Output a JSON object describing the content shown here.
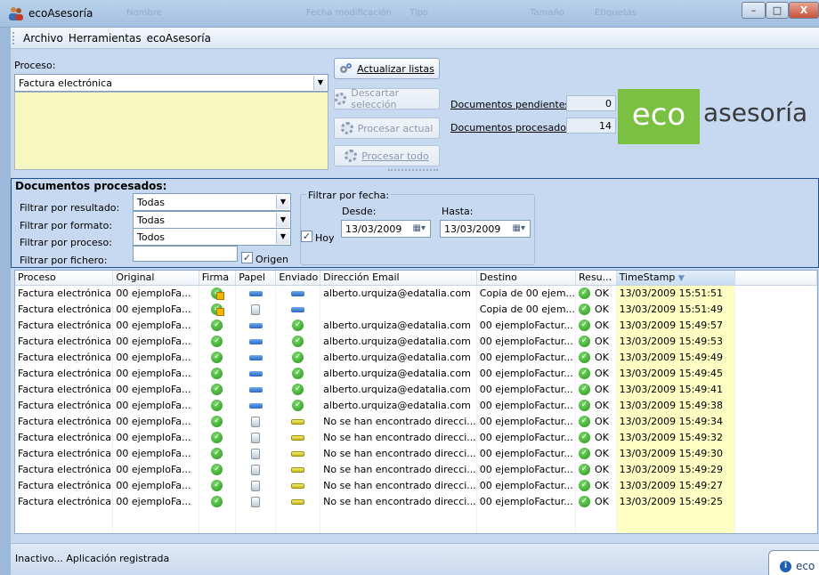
{
  "window": {
    "title": "ecoAsesoría",
    "ghost_columns": [
      "Nombre",
      "Fecha modificación",
      "Tipo",
      "Tamaño",
      "Etiquetas"
    ],
    "min_label": "–",
    "max_label": "□",
    "close_label": "X"
  },
  "menu": [
    "Archivo",
    "Herramientas",
    "ecoAsesoría"
  ],
  "proceso": {
    "label": "Proceso:",
    "selected": "Factura electrónica"
  },
  "buttons": {
    "actualizar": "Actualizar listas",
    "descartar": "Descartar selección",
    "procesar_actual": "Procesar actual",
    "procesar_todo": "Procesar todo"
  },
  "counters": {
    "pendientes_label": "Documentos pendientes:",
    "pendientes_value": "0",
    "procesados_label": "Documentos procesados:",
    "procesados_value": "14"
  },
  "logo": {
    "eco": "eco",
    "rest": "asesoría"
  },
  "filters": {
    "section_title": "Documentos procesados:",
    "resultado_label": "Filtrar por resultado:",
    "resultado_value": "Todas",
    "formato_label": "Filtrar por formato:",
    "formato_value": "Todas",
    "proceso_label": "Filtrar por proceso:",
    "proceso_value": "Todos",
    "fichero_label": "Filtrar por fichero:",
    "fichero_value": "",
    "origen_label": "Origen",
    "origen_checked": true,
    "fecha_group_label": "Filtrar por fecha:",
    "hoy_label": "Hoy",
    "hoy_checked": true,
    "desde_label": "Desde:",
    "desde_value": "13/03/2009",
    "hasta_label": "Hasta:",
    "hasta_value": "13/03/2009"
  },
  "grid": {
    "columns": [
      "Proceso",
      "Original",
      "Firma",
      "Papel",
      "Enviado",
      "Dirección Email",
      "Destino",
      "Resu...",
      "TimeStamp"
    ],
    "sorted_column": "TimeStamp",
    "rows": [
      {
        "proceso": "Factura electrónica",
        "original": "00 ejemploFa...",
        "firma": "warn",
        "papel": "blue",
        "enviado": "blue",
        "email": "alberto.urquiza@edatalia.com",
        "destino": "Copia de 00 ejem...",
        "resultado": "OK",
        "timestamp": "13/03/2009 15:51:51"
      },
      {
        "proceso": "Factura electrónica",
        "original": "00 ejemploFa...",
        "firma": "warn",
        "papel": "paper",
        "enviado": "blue",
        "email": "",
        "destino": "Copia de 00 ejem...",
        "resultado": "OK",
        "timestamp": "13/03/2009 15:51:49"
      },
      {
        "proceso": "Factura electrónica",
        "original": "00 ejemploFa...",
        "firma": "ok",
        "papel": "blue",
        "enviado": "ok",
        "email": "alberto.urquiza@edatalia.com",
        "destino": "00 ejemploFactur...",
        "resultado": "OK",
        "timestamp": "13/03/2009 15:49:57"
      },
      {
        "proceso": "Factura electrónica",
        "original": "00 ejemploFa...",
        "firma": "ok",
        "papel": "blue",
        "enviado": "ok",
        "email": "alberto.urquiza@edatalia.com",
        "destino": "00 ejemploFactur...",
        "resultado": "OK",
        "timestamp": "13/03/2009 15:49:53"
      },
      {
        "proceso": "Factura electrónica",
        "original": "00 ejemploFa...",
        "firma": "ok",
        "papel": "blue",
        "enviado": "ok",
        "email": "alberto.urquiza@edatalia.com",
        "destino": "00 ejemploFactur...",
        "resultado": "OK",
        "timestamp": "13/03/2009 15:49:49"
      },
      {
        "proceso": "Factura electrónica",
        "original": "00 ejemploFa...",
        "firma": "ok",
        "papel": "blue",
        "enviado": "ok",
        "email": "alberto.urquiza@edatalia.com",
        "destino": "00 ejemploFactur...",
        "resultado": "OK",
        "timestamp": "13/03/2009 15:49:45"
      },
      {
        "proceso": "Factura electrónica",
        "original": "00 ejemploFa...",
        "firma": "ok",
        "papel": "blue",
        "enviado": "ok",
        "email": "alberto.urquiza@edatalia.com",
        "destino": "00 ejemploFactur...",
        "resultado": "OK",
        "timestamp": "13/03/2009 15:49:41"
      },
      {
        "proceso": "Factura electrónica",
        "original": "00 ejemploFa...",
        "firma": "ok",
        "papel": "blue",
        "enviado": "ok",
        "email": "alberto.urquiza@edatalia.com",
        "destino": "00 ejemploFactur...",
        "resultado": "OK",
        "timestamp": "13/03/2009 15:49:38"
      },
      {
        "proceso": "Factura electrónica",
        "original": "00 ejemploFa...",
        "firma": "ok",
        "papel": "paper",
        "enviado": "yellow",
        "email": "No se han encontrado direcci...",
        "destino": "00 ejemploFactur...",
        "resultado": "OK",
        "timestamp": "13/03/2009 15:49:34"
      },
      {
        "proceso": "Factura electrónica",
        "original": "00 ejemploFa...",
        "firma": "ok",
        "papel": "paper",
        "enviado": "yellow",
        "email": "No se han encontrado direcci...",
        "destino": "00 ejemploFactur...",
        "resultado": "OK",
        "timestamp": "13/03/2009 15:49:32"
      },
      {
        "proceso": "Factura electrónica",
        "original": "00 ejemploFa...",
        "firma": "ok",
        "papel": "paper",
        "enviado": "yellow",
        "email": "No se han encontrado direcci...",
        "destino": "00 ejemploFactur...",
        "resultado": "OK",
        "timestamp": "13/03/2009 15:49:30"
      },
      {
        "proceso": "Factura electrónica",
        "original": "00 ejemploFa...",
        "firma": "ok",
        "papel": "paper",
        "enviado": "yellow",
        "email": "No se han encontrado direcci...",
        "destino": "00 ejemploFactur...",
        "resultado": "OK",
        "timestamp": "13/03/2009 15:49:29"
      },
      {
        "proceso": "Factura electrónica",
        "original": "00 ejemploFa...",
        "firma": "ok",
        "papel": "paper",
        "enviado": "yellow",
        "email": "No se han encontrado direcci...",
        "destino": "00 ejemploFactur...",
        "resultado": "OK",
        "timestamp": "13/03/2009 15:49:27"
      },
      {
        "proceso": "Factura electrónica",
        "original": "00 ejemploFa...",
        "firma": "ok",
        "papel": "paper",
        "enviado": "yellow",
        "email": "No se han encontrado direcci...",
        "destino": "00 ejemploFactur...",
        "resultado": "OK",
        "timestamp": "13/03/2009 15:49:25"
      }
    ]
  },
  "status": {
    "text": "Inactivo... Aplicación registrada",
    "tray_text": "eco"
  },
  "colors": {
    "client_bg": "#c6d9f0",
    "accent_green": "#7ac142",
    "timestamp_highlight": "#ffffc4"
  }
}
